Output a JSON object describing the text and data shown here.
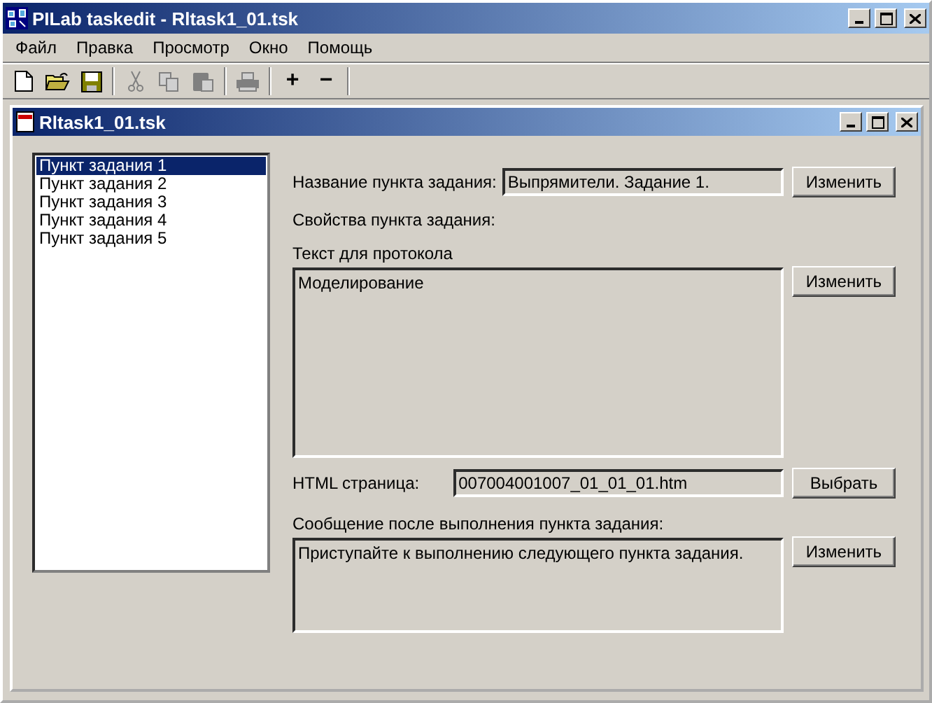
{
  "window": {
    "title": "PILab taskedit - Rltask1_01.tsk"
  },
  "menu": [
    "Файл",
    "Правка",
    "Просмотр",
    "Окно",
    "Помощь"
  ],
  "toolbar": [
    {
      "kind": "new",
      "disabled": false
    },
    {
      "kind": "open",
      "disabled": false
    },
    {
      "kind": "save",
      "disabled": false
    },
    {
      "kind": "separator"
    },
    {
      "kind": "cut",
      "disabled": true
    },
    {
      "kind": "copy",
      "disabled": true
    },
    {
      "kind": "paste",
      "disabled": true
    },
    {
      "kind": "separator"
    },
    {
      "kind": "print",
      "disabled": true
    },
    {
      "kind": "separator"
    },
    {
      "kind": "text",
      "label": "+",
      "disabled": false
    },
    {
      "kind": "text",
      "label": "−",
      "disabled": false
    },
    {
      "kind": "separator"
    }
  ],
  "document": {
    "title": "Rltask1_01.tsk",
    "items": [
      {
        "label": "Пункт задания 1",
        "selected": true
      },
      {
        "label": "Пункт задания 2",
        "selected": false
      },
      {
        "label": "Пункт задания 3",
        "selected": false
      },
      {
        "label": "Пункт задания 4",
        "selected": false
      },
      {
        "label": "Пункт задания 5",
        "selected": false
      }
    ],
    "name_label": "Название пункта задания:",
    "name_value": "Выпрямители. Задание 1.",
    "name_button": "Изменить",
    "properties_label": "Свойства пункта задания:",
    "protocol_label": "Текст для протокола",
    "protocol_value": "Моделирование",
    "protocol_button": "Изменить",
    "html_label": "HTML страница:",
    "html_value": "007004001007_01_01_01.htm",
    "html_button": "Выбрать",
    "message_label": "Сообщение после выполнения пункта задания:",
    "message_value": "Приступайте к выполнению следующего пункта задания.",
    "message_button": "Изменить"
  }
}
